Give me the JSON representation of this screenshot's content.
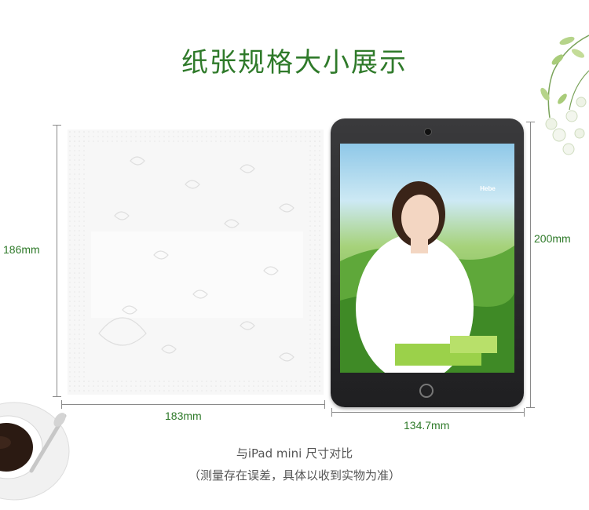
{
  "title": "纸张规格大小展示",
  "dimensions": {
    "tissue_height": "186mm",
    "tissue_width": "183mm",
    "tablet_height": "200mm",
    "tablet_width": "134.7mm"
  },
  "captions": {
    "comparison": "与iPad mini 尺寸对比",
    "note": "（测量存在误差，具体以收到实物为准）"
  },
  "tablet_ad": {
    "brand_text": "Hebe"
  },
  "colors": {
    "accent_green": "#2f7a2a",
    "dimension_line": "#8a8a8a"
  },
  "icons": [
    "flower-sprig-icon",
    "coffee-cup-icon",
    "tablet-home-button-icon"
  ]
}
